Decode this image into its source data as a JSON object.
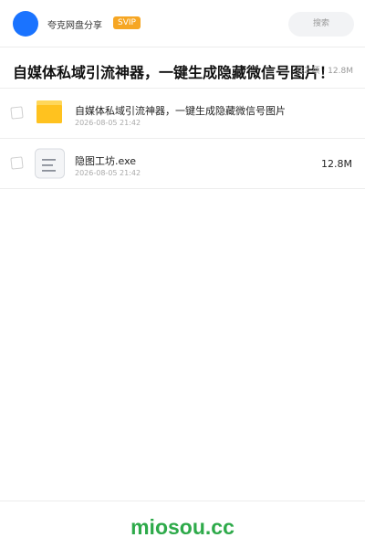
{
  "header": {
    "app_name": "夸克网盘分享",
    "vip_badge": "SVIP",
    "search_label": "搜索"
  },
  "share": {
    "title": "自媒体私域引流神器，一键生成隐藏微信号图片！",
    "meta": "共2 项 · 12.8M"
  },
  "files": [
    {
      "name": "自媒体私域引流神器，一键生成隐藏微信号图片",
      "date": "2026-08-05 21:42",
      "size": "",
      "icon": "folder-icon"
    },
    {
      "name": "隐图工坊.exe",
      "date": "2026-08-05 21:42",
      "size": "12.8M",
      "icon": "file-document-icon"
    }
  ],
  "footer": {
    "watermark": "miosou.cc"
  },
  "colors": {
    "accent_blue": "#1a73ff",
    "vip_orange": "#f6a623",
    "folder_yellow": "#ffc21f",
    "watermark_green": "#2eaa4a"
  }
}
